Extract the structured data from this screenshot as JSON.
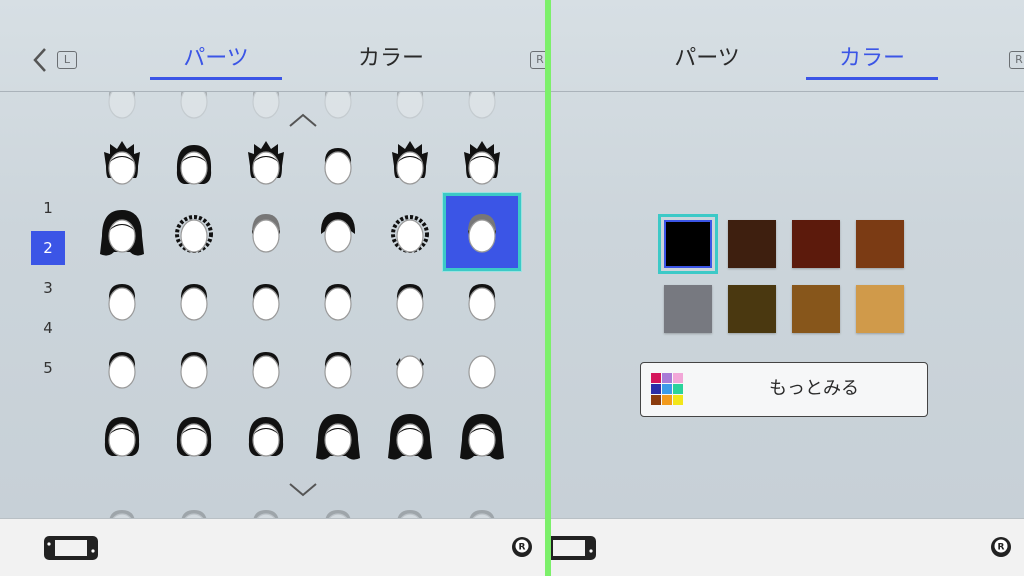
{
  "left_panel": {
    "back_button_badge": "L",
    "tabs": [
      {
        "label": "パーツ",
        "active": true
      },
      {
        "label": "カラー",
        "active": false
      }
    ],
    "right_badge": "R",
    "pages": [
      {
        "label": "1",
        "active": false
      },
      {
        "label": "2",
        "active": true
      },
      {
        "label": "3",
        "active": false
      },
      {
        "label": "4",
        "active": false
      },
      {
        "label": "5",
        "active": false
      }
    ],
    "hair_grid": {
      "rows": 5,
      "columns": 6,
      "selected_row": 2,
      "selected_column": 6,
      "icons": [
        [
          "hair-spiky-medium-icon",
          "hair-bob-icon",
          "hair-spiky-wild-icon",
          "hair-short-straight-icon",
          "hair-spiky-bangs-icon",
          "hair-messy-spiky-icon"
        ],
        [
          "hair-long-wavy-icon",
          "hair-curly-short-icon",
          "hair-beanie-icon",
          "hair-bowl-cut-icon",
          "hair-curly-round-icon",
          "hair-knit-cap-icon"
        ],
        [
          "hair-buzz-icon",
          "hair-crew-cut-icon",
          "hair-side-part-icon",
          "hair-short-bangs-icon",
          "hair-flat-top-icon",
          "hair-high-flat-icon"
        ],
        [
          "hair-short-crop-icon",
          "hair-side-swept-icon",
          "hair-receding-icon",
          "hair-short-fringe-icon",
          "hair-side-only-icon",
          "hair-bald-icon"
        ],
        [
          "hair-bob-bangs-icon",
          "hair-rounded-bob-icon",
          "hair-helmet-bob-icon",
          "hair-long-center-part-icon",
          "hair-long-side-part-icon",
          "hair-long-straight-bangs-icon"
        ]
      ]
    }
  },
  "right_panel": {
    "tabs": [
      {
        "label": "パーツ",
        "active": false
      },
      {
        "label": "カラー",
        "active": true
      }
    ],
    "right_badge": "R",
    "colors": [
      "#000000",
      "#3e1f0f",
      "#5c1a0c",
      "#7b3b14",
      "#777980",
      "#4a3810",
      "#87561b",
      "#d09a4a"
    ],
    "selected_color_index": 0,
    "more_button_label": "もっとみる",
    "palette_icon_colors": [
      "#d4155b",
      "#a87bd6",
      "#f2a7d8",
      "#2a2ea8",
      "#3b9be8",
      "#2bd39b",
      "#8a3b0e",
      "#f29a1c",
      "#f2e61a"
    ]
  },
  "accent_colors": {
    "active_tab": "#3b55e6",
    "selection_ring": "#3cc9c7",
    "divider": "#7cf06a"
  },
  "footer": {
    "left_icon": "handheld-console-icon",
    "right_icon": "r-stick-icon"
  }
}
